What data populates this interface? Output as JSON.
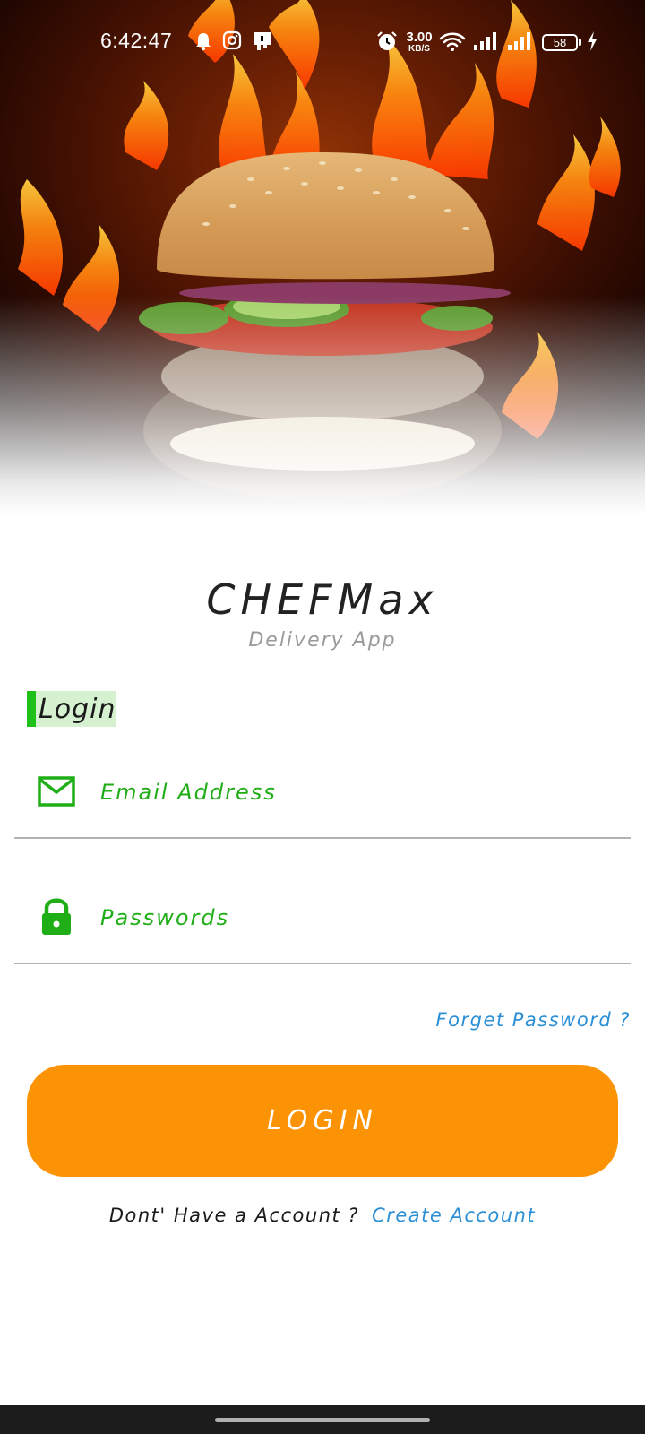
{
  "status_bar": {
    "time": "6:42:47",
    "net_speed_value": "3.00",
    "net_speed_unit": "KB/S",
    "battery_level": "58",
    "icons": [
      "bell-icon",
      "instagram-icon",
      "app-notification-icon",
      "alarm-icon",
      "wifi-icon",
      "signal-icon",
      "signal-icon",
      "battery-icon",
      "charging-icon"
    ]
  },
  "hero": {
    "image": "burger-with-flames"
  },
  "brand": {
    "title": "CHEFMax",
    "subtitle": "Delivery App"
  },
  "login_form": {
    "heading": "Login",
    "email": {
      "placeholder": "Email Address",
      "value": "",
      "icon": "mail-icon"
    },
    "password": {
      "placeholder": "Passwords",
      "value": "",
      "icon": "lock-icon"
    },
    "forget_password": "Forget Password ?",
    "login_button": "LOGIN",
    "no_account_text": "Dont' Have a Account ?",
    "create_account": "Create Account"
  },
  "colors": {
    "accent_green": "#1fae16",
    "button_orange": "#fc9304",
    "link_blue": "#2c8fd6",
    "heading_highlight": "#d6f1cf"
  }
}
